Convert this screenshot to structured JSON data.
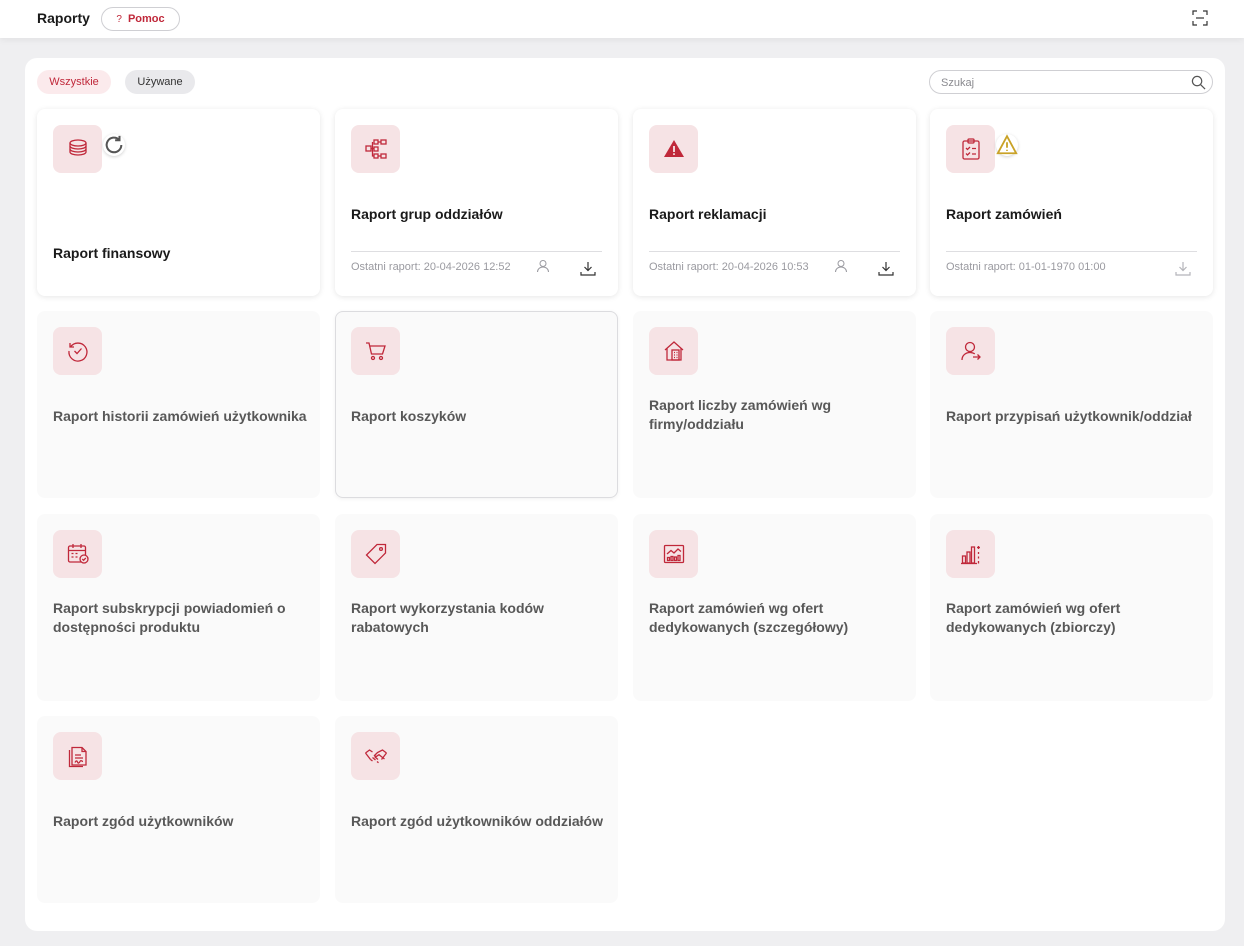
{
  "header": {
    "title": "Raporty",
    "help_label": "Pomoc",
    "help_mark": "?"
  },
  "filters": {
    "all_label": "Wszystkie",
    "used_label": "Używane"
  },
  "search": {
    "placeholder": "Szukaj"
  },
  "accent_color": "#c0283a",
  "icon_bg_color": "#f6e3e5",
  "reports": [
    {
      "title": "Raport finansowy",
      "icon": "coins-stack-icon",
      "badge": "refresh-icon"
    },
    {
      "title": "Raport grup oddziałów",
      "icon": "hierarchy-icon",
      "last_report": "Ostatni raport: 20-04-2026 12:52"
    },
    {
      "title": "Raport reklamacji",
      "icon": "warning-triangle-icon",
      "last_report": "Ostatni raport: 20-04-2026 10:53"
    },
    {
      "title": "Raport zamówień",
      "icon": "clipboard-check-icon",
      "badge": "warning-icon",
      "last_report": "Ostatni raport: 01-01-1970 01:00"
    },
    {
      "title": "Raport historii zamówień użytkownika",
      "icon": "history-check-icon"
    },
    {
      "title": "Raport koszyków",
      "icon": "cart-icon"
    },
    {
      "title": "Raport liczby zamówień wg firmy/oddziału",
      "icon": "building-icon"
    },
    {
      "title": "Raport przypisań użytkownik/oddział",
      "icon": "user-assign-icon"
    },
    {
      "title": "Raport subskrypcji powiadomień o dostępności produktu",
      "icon": "calendar-check-icon"
    },
    {
      "title": "Raport wykorzystania kodów rabatowych",
      "icon": "tag-icon"
    },
    {
      "title": "Raport zamówień wg ofert dedykowanych (szczegółowy)",
      "icon": "chart-image-icon"
    },
    {
      "title": "Raport zamówień wg ofert dedykowanych (zbiorczy)",
      "icon": "bar-chart-icon"
    },
    {
      "title": "Raport zgód użytkowników",
      "icon": "document-sign-icon"
    },
    {
      "title": "Raport zgód użytkowników oddziałów",
      "icon": "handshake-icon"
    }
  ]
}
